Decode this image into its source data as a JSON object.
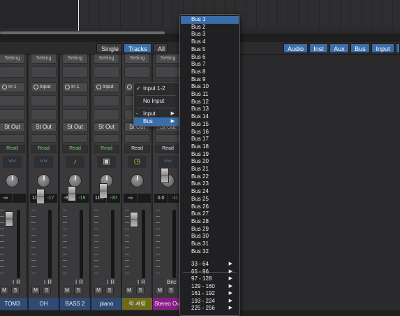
{
  "mixer": {
    "view_buttons": [
      "Single",
      "Tracks",
      "All"
    ],
    "active_view": "Tracks",
    "filter_buttons": [
      "Audio",
      "Inst",
      "Aux",
      "Bus",
      "Input"
    ],
    "setting_label": "Setting"
  },
  "strips": [
    {
      "name": "TOM3",
      "input": "In 1",
      "output": "St Out",
      "automation": "Read",
      "volume": "-∞",
      "peak": "",
      "icon": "waveform-icon",
      "name_color": "#2f4a74",
      "read_color": "#6fd36f"
    },
    {
      "name": "OH",
      "input": "Input",
      "output": "St Out",
      "automation": "Read",
      "volume": "11.0",
      "peak": "-17",
      "icon": "waveform-icon",
      "name_color": "#2f4a74",
      "read_color": "#6fd36f"
    },
    {
      "name": "BASS 2",
      "input": "In 1",
      "output": "St Out",
      "automation": "Read",
      "volume": "-8.4",
      "peak": "-19",
      "icon": "violin-icon",
      "name_color": "#2f4a74",
      "read_color": "#6fd36f"
    },
    {
      "name": "piano",
      "input": "Input",
      "output": "St Out",
      "automation": "Read",
      "volume": "11.2",
      "peak": "-20",
      "icon": "amp-icon",
      "name_color": "#2f4a74",
      "read_color": "#6fd36f"
    },
    {
      "name": "릭 셔링",
      "input": "Input",
      "output": "St Out",
      "automation": "Read",
      "volume": "-∞",
      "peak": "",
      "icon": "clock-icon",
      "name_color": "#6d6a1e",
      "read_color": "#e6e6e6"
    },
    {
      "name": "Stereo Out",
      "input": "",
      "output": "St Out",
      "automation": "Read",
      "volume": "0.0",
      "peak": "-11",
      "icon": "waveform-icon",
      "name_color": "#8a1e8a",
      "read_color": "#e6e6e6"
    }
  ],
  "strip_controls": {
    "input_monitor": "I",
    "record": "R",
    "mute": "M",
    "solo": "S",
    "bounce": "Bnc"
  },
  "input_menu": {
    "selected": "Input 1-2",
    "items": [
      "Input 1-2",
      "No Input",
      "Input",
      "Bus"
    ],
    "highlighted": "Bus"
  },
  "bus_menu": {
    "highlighted": "Bus 1",
    "buses": [
      "Bus 1",
      "Bus 2",
      "Bus 3",
      "Bus 4",
      "Bus 5",
      "Bus 6",
      "Bus 7",
      "Bus 8",
      "Bus 9",
      "Bus 10",
      "Bus 11",
      "Bus 12",
      "Bus 13",
      "Bus 14",
      "Bus 15",
      "Bus 16",
      "Bus 17",
      "Bus 18",
      "Bus 19",
      "Bus 20",
      "Bus 21",
      "Bus 22",
      "Bus 23",
      "Bus 24",
      "Bus 25",
      "Bus 26",
      "Bus 27",
      "Bus 28",
      "Bus 29",
      "Bus 30",
      "Bus 31",
      "Bus 32"
    ],
    "ranges": [
      "33 - 64",
      "65 - 96",
      "97 - 128",
      "129 - 160",
      "161 - 192",
      "193 - 224",
      "225 - 256"
    ]
  }
}
